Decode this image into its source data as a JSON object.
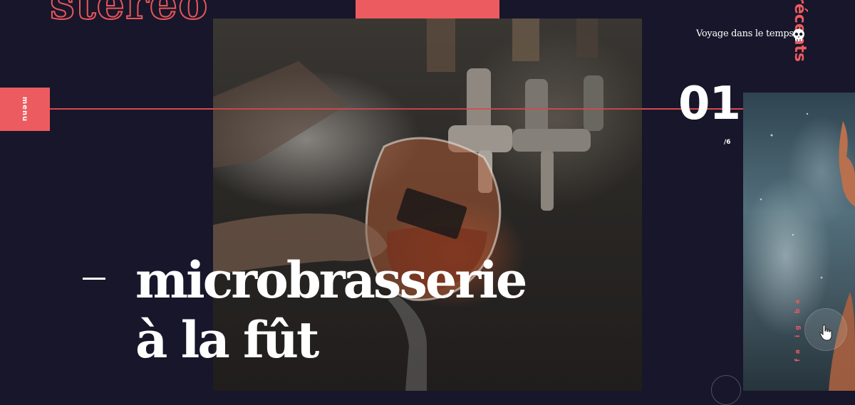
{
  "brand": {
    "logo_text": "stereo"
  },
  "menu": {
    "label": "menu"
  },
  "header": {
    "recent_label": "récents",
    "time_travel_label": "Voyage dans le temps"
  },
  "slider": {
    "current": "01",
    "total": "/6"
  },
  "hero": {
    "title_line1": "microbrasserie",
    "title_line2": "à la fût",
    "image_alt": "Beer tap pouring into a glass"
  },
  "next_card": {
    "tag": "fa ig be in"
  },
  "icons": {
    "skull": "skull-icon",
    "cursor": "hand-cursor-icon"
  },
  "colors": {
    "background": "#17162a",
    "accent": "#ec5b5f",
    "text": "#ffffff"
  }
}
